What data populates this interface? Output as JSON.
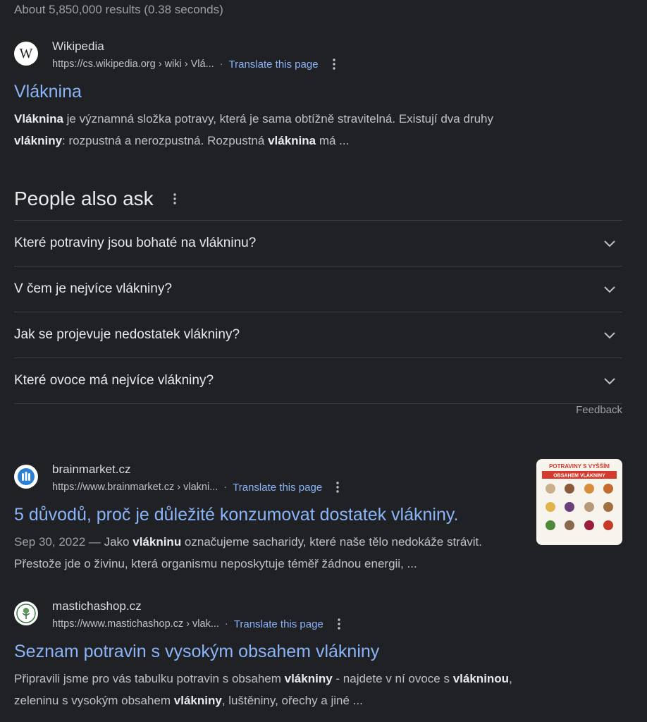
{
  "stats": "About 5,850,000 results (0.38 seconds)",
  "results": [
    {
      "site": "Wikipedia",
      "url": "https://cs.wikipedia.org › wiki › Vlá...",
      "translate": "Translate this page",
      "title": "Vláknina",
      "snippet_parts": [
        {
          "t": "Vláknina",
          "b": true
        },
        {
          "t": " je významná složka potravy, která je sama obtížně stravitelná. Existují dva druhy ",
          "b": false
        },
        {
          "t": "vlákniny",
          "b": true
        },
        {
          "t": ": rozpustná a nerozpustná. Rozpustná ",
          "b": false
        },
        {
          "t": "vláknina",
          "b": true
        },
        {
          "t": " má ...",
          "b": false
        }
      ]
    },
    {
      "site": "brainmarket.cz",
      "url": "https://www.brainmarket.cz › vlakni...",
      "translate": "Translate this page",
      "title": "5 důvodů, proč je důležité konzumovat dostatek vlákniny.",
      "date": "Sep 30, 2022 — ",
      "snippet_parts": [
        {
          "t": "Jako ",
          "b": false
        },
        {
          "t": "vlákninu",
          "b": true
        },
        {
          "t": " označujeme sacharidy, které naše tělo nedokáže strávit. Přestože jde o živinu, která organismu neposkytuje téměř žádnou energii, ...",
          "b": false
        }
      ],
      "thumbnail": {
        "header1": "POTRAVINY S VYŠŠÍM",
        "header2": "OBSAHEM VLÁKNINY"
      }
    },
    {
      "site": "mastichashop.cz",
      "url": "https://www.mastichashop.cz › vlak...",
      "translate": "Translate this page",
      "title": "Seznam potravin s vysokým obsahem vlákniny",
      "snippet_parts": [
        {
          "t": "Připravili jsme pro vás tabulku potravin s obsahem ",
          "b": false
        },
        {
          "t": "vlákniny",
          "b": true
        },
        {
          "t": " - najdete v ní ovoce s ",
          "b": false
        },
        {
          "t": "vlákninou",
          "b": true
        },
        {
          "t": ", zeleninu s vysokým obsahem ",
          "b": false
        },
        {
          "t": "vlákniny",
          "b": true
        },
        {
          "t": ", luštěniny, ořechy a jiné ...",
          "b": false
        }
      ]
    }
  ],
  "paa": {
    "title": "People also ask",
    "questions": [
      "Které potraviny jsou bohaté na vlákninu?",
      "V čem je nejvíce vlákniny?",
      "Jak se projevuje nedostatek vlákniny?",
      "Které ovoce má nejvíce vlákniny?"
    ],
    "feedback": "Feedback"
  },
  "colors": {
    "background": "#202124",
    "link": "#8ab4f8",
    "text": "#bdc1c6",
    "bold": "#e8eaed"
  },
  "icons": [
    "wikipedia-logo-icon",
    "brainmarket-logo-icon",
    "mastichashop-logo-icon",
    "more-vert-icon",
    "chevron-down-icon"
  ]
}
